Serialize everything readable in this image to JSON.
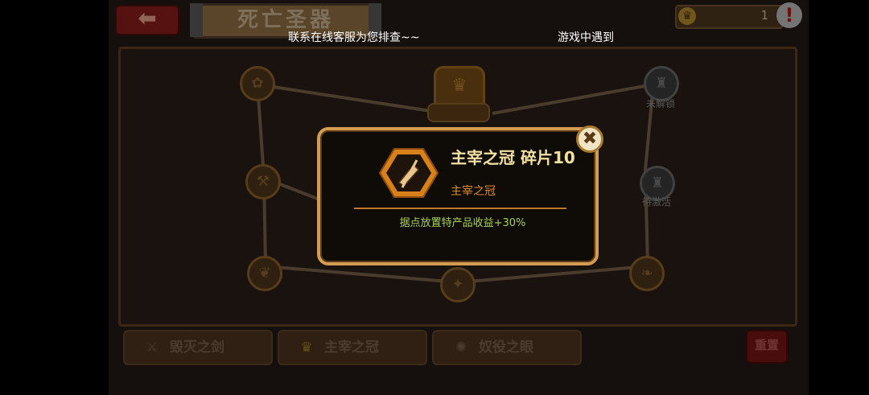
{
  "header": {
    "back_label": "⬅",
    "title": "死亡圣器",
    "resource_value": "1",
    "resource_icon": "crown-coin-icon",
    "alert_label": "!"
  },
  "notices": {
    "left": "联系在线客服为您排查~~",
    "right": "游戏中遇到"
  },
  "tree": {
    "locked_label": "未解锁",
    "pending_label": "待激活"
  },
  "tabs": [
    {
      "label": "毁灭之剑",
      "icon": "sword-icon"
    },
    {
      "label": "主宰之冠",
      "icon": "crown-icon"
    },
    {
      "label": "奴役之眼",
      "icon": "eye-icon"
    }
  ],
  "reset_label": "重置",
  "popup": {
    "title": "主宰之冠 碎片10",
    "subtitle": "主宰之冠",
    "effect": "据点放置特产品收益+30%",
    "close_label": "✖",
    "icon": "hand-scroll-icon"
  },
  "colors": {
    "popup_border": "#d49c50",
    "title": "#f1e0a0",
    "subtitle": "#e08a2a",
    "effect": "#a8d058"
  }
}
